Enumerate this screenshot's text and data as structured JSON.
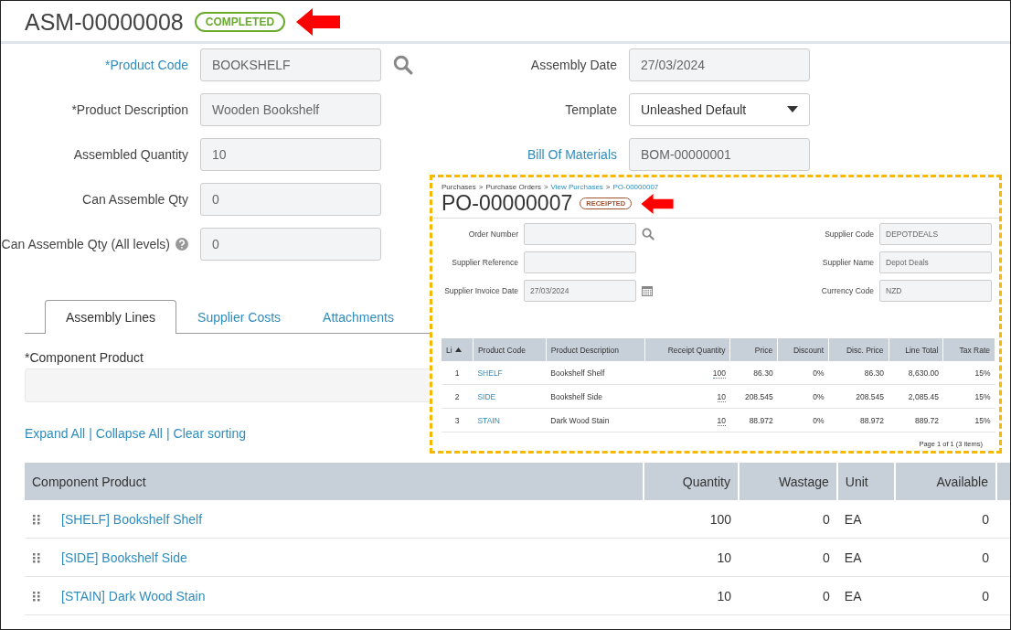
{
  "header": {
    "title": "ASM-00000008",
    "status": "COMPLETED"
  },
  "form_left": [
    {
      "label": "*Product Code",
      "value": "BOOKSHELF",
      "kind": "lookup",
      "link_label": true
    },
    {
      "label": "*Product Description",
      "value": "Wooden Bookshelf",
      "kind": "text",
      "link_label": false
    },
    {
      "label": "Assembled Quantity",
      "value": "10",
      "kind": "text",
      "link_label": false
    },
    {
      "label": "Can Assemble Qty",
      "value": "0",
      "kind": "text",
      "link_label": false
    },
    {
      "label": "Can Assemble Qty (All levels)",
      "value": "0",
      "kind": "help",
      "link_label": false
    }
  ],
  "form_right": [
    {
      "label": "Assembly Date",
      "value": "27/03/2024",
      "kind": "readonly",
      "link_label": false
    },
    {
      "label": "Template",
      "value": "Unleashed Default",
      "kind": "select",
      "link_label": false
    },
    {
      "label": "Bill Of Materials",
      "value": "BOM-00000001",
      "kind": "readonly",
      "link_label": true
    }
  ],
  "tabs": [
    {
      "label": "Assembly Lines",
      "selected": true
    },
    {
      "label": "Supplier Costs",
      "selected": false
    },
    {
      "label": "Attachments",
      "selected": false
    }
  ],
  "component_field": {
    "label": "*Component Product"
  },
  "actions": [
    "Expand All",
    "|",
    "Collapse All",
    "|",
    "Clear sorting"
  ],
  "table": {
    "columns": [
      "Component Product",
      "Quantity",
      "Wastage",
      "Unit",
      "Available"
    ],
    "rows": [
      [
        "[SHELF] Bookshelf Shelf",
        "100",
        "0",
        "EA",
        "0"
      ],
      [
        "[SIDE] Bookshelf Side",
        "10",
        "0",
        "EA",
        "0"
      ],
      [
        "[STAIN] Dark Wood Stain",
        "10",
        "0",
        "EA",
        "0"
      ]
    ]
  },
  "overlay": {
    "breadcrumb": [
      {
        "text": "Purchases",
        "kind": "text"
      },
      {
        "text": ">",
        "kind": "separator"
      },
      {
        "text": "Purchase Orders",
        "kind": "text"
      },
      {
        "text": ">",
        "kind": "separator"
      },
      {
        "text": "View Purchases",
        "kind": "link"
      },
      {
        "text": ">",
        "kind": "separator"
      },
      {
        "text": "PO-00000007",
        "kind": "link"
      }
    ],
    "title": "PO-00000007",
    "status": "RECEIPTED",
    "fields_left": [
      {
        "label": "Order Number",
        "kind": "lookup"
      },
      {
        "label": "Supplier Reference",
        "kind": "text"
      },
      {
        "label": "Supplier Invoice Date",
        "value": "27/03/2024",
        "kind": "date"
      }
    ],
    "fields_right": [
      {
        "label": "Supplier Code",
        "value": "DEPOTDEALS"
      },
      {
        "label": "Supplier Name",
        "value": "Depot Deals"
      },
      {
        "label": "Currency Code",
        "value": "NZD"
      }
    ],
    "table": {
      "columns": [
        "Li",
        "Product Code",
        "Product Description",
        "Receipt Quantity",
        "Price",
        "Discount",
        "Disc. Price",
        "Line Total",
        "Tax Rate"
      ],
      "rows": [
        [
          "1",
          "SHELF",
          "Bookshelf Shelf",
          "100",
          "86.30",
          "0%",
          "86.30",
          "8,630.00",
          "15%"
        ],
        [
          "2",
          "SIDE",
          "Bookshelf Side",
          "10",
          "208.545",
          "0%",
          "208.545",
          "2,085.45",
          "15%"
        ],
        [
          "3",
          "STAIN",
          "Dark Wood Stain",
          "10",
          "88.972",
          "0%",
          "88.972",
          "889.72",
          "15%"
        ]
      ]
    },
    "pager": "Page 1 of 1 (3 items)"
  }
}
